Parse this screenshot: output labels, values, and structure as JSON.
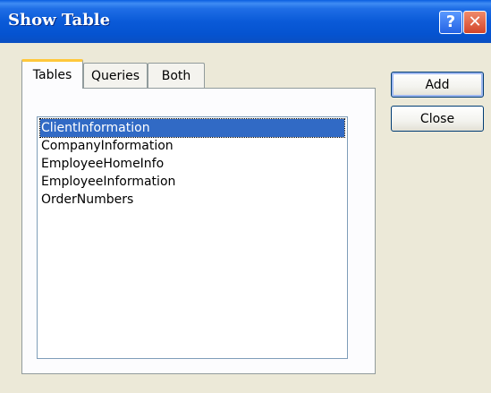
{
  "window": {
    "title": "Show Table",
    "help_label": "?",
    "close_label": "✕"
  },
  "tabs": [
    {
      "label": "Tables",
      "active": true
    },
    {
      "label": "Queries",
      "active": false
    },
    {
      "label": "Both",
      "active": false
    }
  ],
  "list": {
    "items": [
      {
        "label": "ClientInformation",
        "selected": true
      },
      {
        "label": "CompanyInformation",
        "selected": false
      },
      {
        "label": "EmployeeHomeInfo",
        "selected": false
      },
      {
        "label": "EmployeeInformation",
        "selected": false
      },
      {
        "label": "OrderNumbers",
        "selected": false
      }
    ]
  },
  "buttons": {
    "add_label": "Add",
    "close_label": "Close"
  },
  "colors": {
    "titlebar": "#0a5ad8",
    "selection": "#316ac5",
    "tab_highlight": "#ffc83c",
    "dialog_bg": "#ece9d8"
  },
  "icons": {
    "help": "help-icon",
    "close": "close-icon"
  }
}
